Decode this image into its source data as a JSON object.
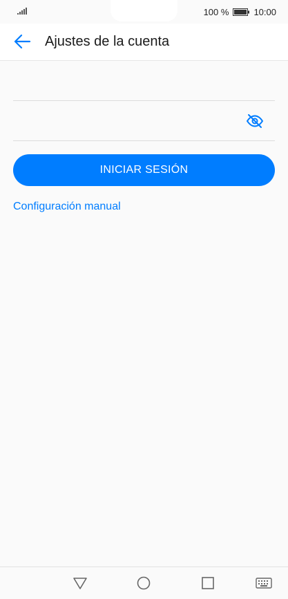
{
  "status_bar": {
    "battery_text": "100 %",
    "time": "10:00",
    "signal_icon": "signal-icon",
    "battery_icon": "battery-icon"
  },
  "header": {
    "title": "Ajustes de la cuenta",
    "back_icon": "arrow-left-icon"
  },
  "form": {
    "email_value": "",
    "password_value": "",
    "password_toggle_icon": "eye-off-icon",
    "login_label": "INICIAR SESIÓN",
    "manual_link": "Configuración manual"
  },
  "nav_bar": {
    "icons": [
      "back-triangle-icon",
      "home-circle-icon",
      "recents-square-icon",
      "keyboard-icon"
    ]
  },
  "colors": {
    "accent": "#007dff",
    "background": "#fafafa",
    "header_bg": "#ffffff"
  }
}
